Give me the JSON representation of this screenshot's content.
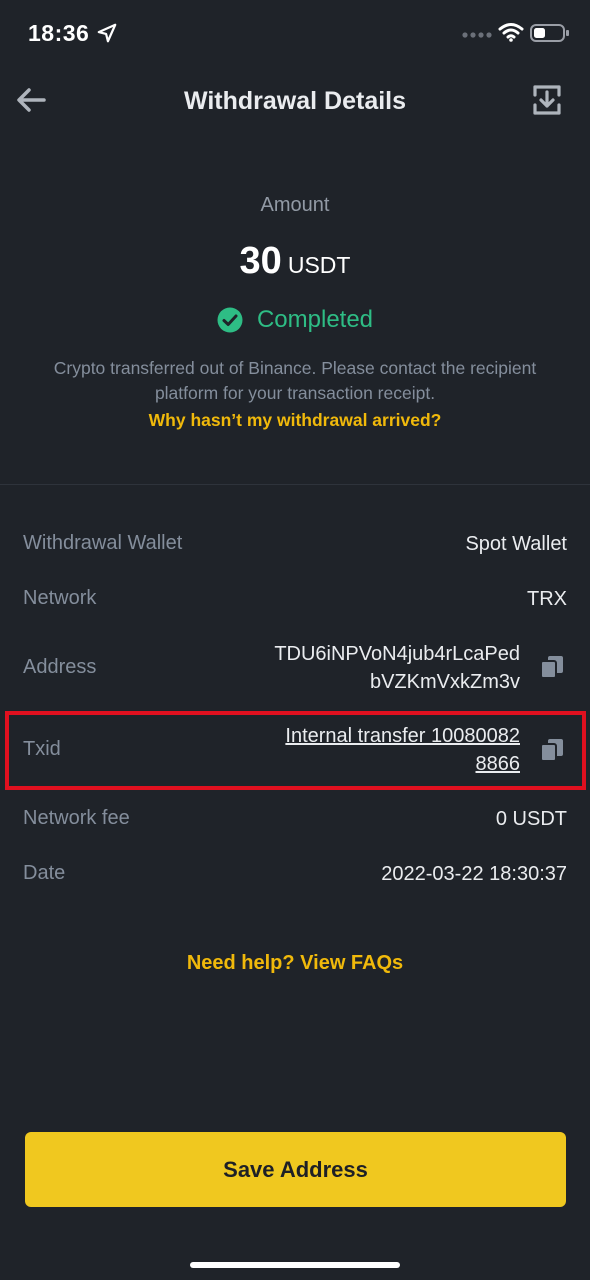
{
  "status_bar": {
    "time": "18:36"
  },
  "header": {
    "title": "Withdrawal Details"
  },
  "summary": {
    "amount_label": "Amount",
    "amount_value": "30",
    "amount_unit": "USDT",
    "status": "Completed",
    "info_text": "Crypto transferred out of Binance. Please contact the recipient platform for your transaction receipt.",
    "info_link": "Why hasn’t my withdrawal arrived?"
  },
  "details": {
    "wallet_label": "Withdrawal Wallet",
    "wallet_value": "Spot Wallet",
    "network_label": "Network",
    "network_value": "TRX",
    "address_label": "Address",
    "address_line1": "TDU6iNPVoN4jub4rLcaPed",
    "address_line2": "bVZKmVxkZm3v",
    "txid_label": "Txid",
    "txid_line1": "Internal transfer 10080082",
    "txid_line2": "8866",
    "fee_label": "Network fee",
    "fee_value": "0 USDT",
    "date_label": "Date",
    "date_value": "2022-03-22 18:30:37"
  },
  "help_link": "Need help? View FAQs",
  "save_button": "Save Address",
  "colors": {
    "background": "#1f2329",
    "accent": "#f0b90b",
    "success": "#2ebd85",
    "button": "#f0c81f",
    "highlight": "#e0101f"
  },
  "icons": [
    "location-arrow-icon",
    "signal-dots-icon",
    "wifi-icon",
    "battery-icon",
    "back-arrow-icon",
    "share-icon",
    "check-circle-icon",
    "copy-icon"
  ]
}
